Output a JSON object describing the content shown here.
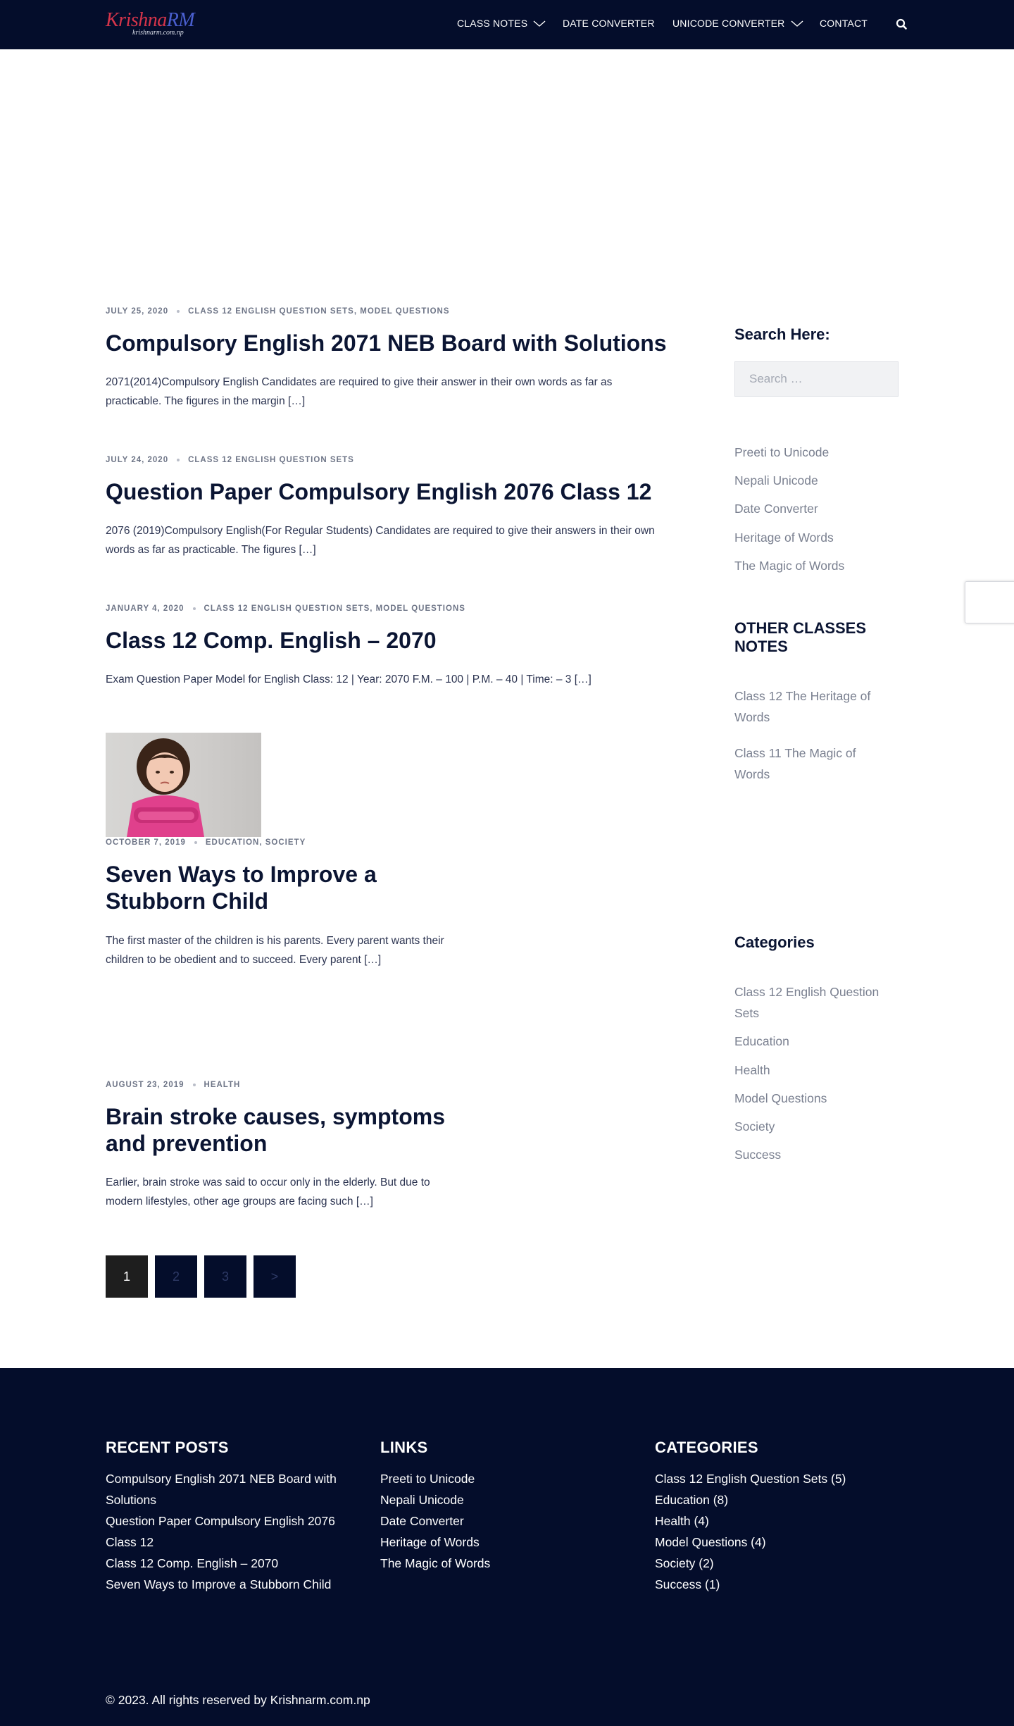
{
  "header": {
    "logo_main_k": "Krishna",
    "logo_main_rm": "RM",
    "logo_sub": "krishnarm.com.np",
    "nav": [
      {
        "label": "CLASS NOTES"
      },
      {
        "label": "DATE CONVERTER"
      },
      {
        "label": "UNICODE CONVERTER"
      },
      {
        "label": "CONTACT"
      }
    ]
  },
  "posts": [
    {
      "date": "JULY 25, 2020",
      "categories": "CLASS 12 ENGLISH QUESTION SETS, MODEL QUESTIONS",
      "title": "Compulsory English 2071 NEB Board with Solutions",
      "excerpt_line1": "2071(2014)Compulsory English Candidates are required to give their answer in their own words as far as",
      "excerpt_line2": "practicable. The figures in the margin […]"
    },
    {
      "date": "JULY 24, 2020",
      "categories": "CLASS 12 ENGLISH QUESTION SETS",
      "title": "Question Paper Compulsory English 2076 Class 12",
      "excerpt_line1": "2076 (2019)Compulsory English(For Regular Students) Candidates are required to give their answers in their own",
      "excerpt_line2": "words as far as practicable. The figures […]"
    },
    {
      "date": "JANUARY 4, 2020",
      "categories": "CLASS 12 ENGLISH QUESTION SETS, MODEL QUESTIONS",
      "title": "Class 12 Comp. English – 2070",
      "excerpt_line1": "Exam Question Paper Model for English Class: 12 | Year: 2070 F.M. – 100 | P.M. – 40 | Time: – 3 […]",
      "excerpt_line2": ""
    },
    {
      "date": "OCTOBER 7, 2019",
      "categories": "EDUCATION, SOCIETY",
      "title_line1": "Seven Ways to Improve a",
      "title_line2": "Stubborn Child",
      "excerpt_line1": "The first master of the children is his parents. Every parent wants their",
      "excerpt_line2": "children to be obedient and to succeed. Every parent […]"
    },
    {
      "date": "AUGUST 23, 2019",
      "categories": "HEALTH",
      "title_line1": "Brain stroke causes, symptoms",
      "title_line2": "and prevention",
      "excerpt_line1": "Earlier, brain stroke was said to occur only in the elderly.  But due to",
      "excerpt_line2": "modern lifestyles, other age groups are facing such […]"
    }
  ],
  "pagination": [
    "1",
    "2",
    "3",
    ">"
  ],
  "pagination_current": "1",
  "sidebar": {
    "search_heading": "Search Here:",
    "search_placeholder": "Search …",
    "links": [
      "Preeti to Unicode",
      "Nepali Unicode",
      "Date Converter",
      "Heritage of Words",
      "The Magic of Words"
    ],
    "other_heading_line1": "OTHER CLASSES",
    "other_heading_line2": "NOTES",
    "other_links": [
      {
        "line1": "Class 12 The Heritage of",
        "line2": "Words"
      },
      {
        "line1": "Class 11 The Magic of",
        "line2": "Words"
      }
    ],
    "categories_heading": "Categories",
    "categories_first_line1": "Class 12 English Question",
    "categories_first_line2": "Sets",
    "categories": [
      "Education",
      "Health",
      "Model Questions",
      "Society",
      "Success"
    ]
  },
  "footer": {
    "recent_heading": "RECENT POSTS",
    "recent": [
      "Compulsory English 2071 NEB Board with",
      "Solutions",
      "Question Paper Compulsory English 2076",
      "Class 12",
      "Class 12 Comp. English – 2070",
      "Seven Ways to Improve a Stubborn Child"
    ],
    "links_heading": "LINKS",
    "links": [
      "Preeti to Unicode",
      "Nepali Unicode",
      "Date Converter",
      "Heritage of Words",
      "The Magic of Words"
    ],
    "categories_heading": "CATEGORIES",
    "categories": [
      "Class 12 English Question Sets (5)",
      "Education (8)",
      "Health (4)",
      "Model Questions (4)",
      "Society (2)",
      "Success (1)"
    ],
    "copyright": "© 2023. All rights reserved by Krishnarm.com.np"
  },
  "colors": {
    "navy": "#040d2b",
    "title_text": "#0b1533",
    "muted": "#7a8090"
  },
  "icons": [
    "search-icon",
    "chevron-down-icon"
  ]
}
